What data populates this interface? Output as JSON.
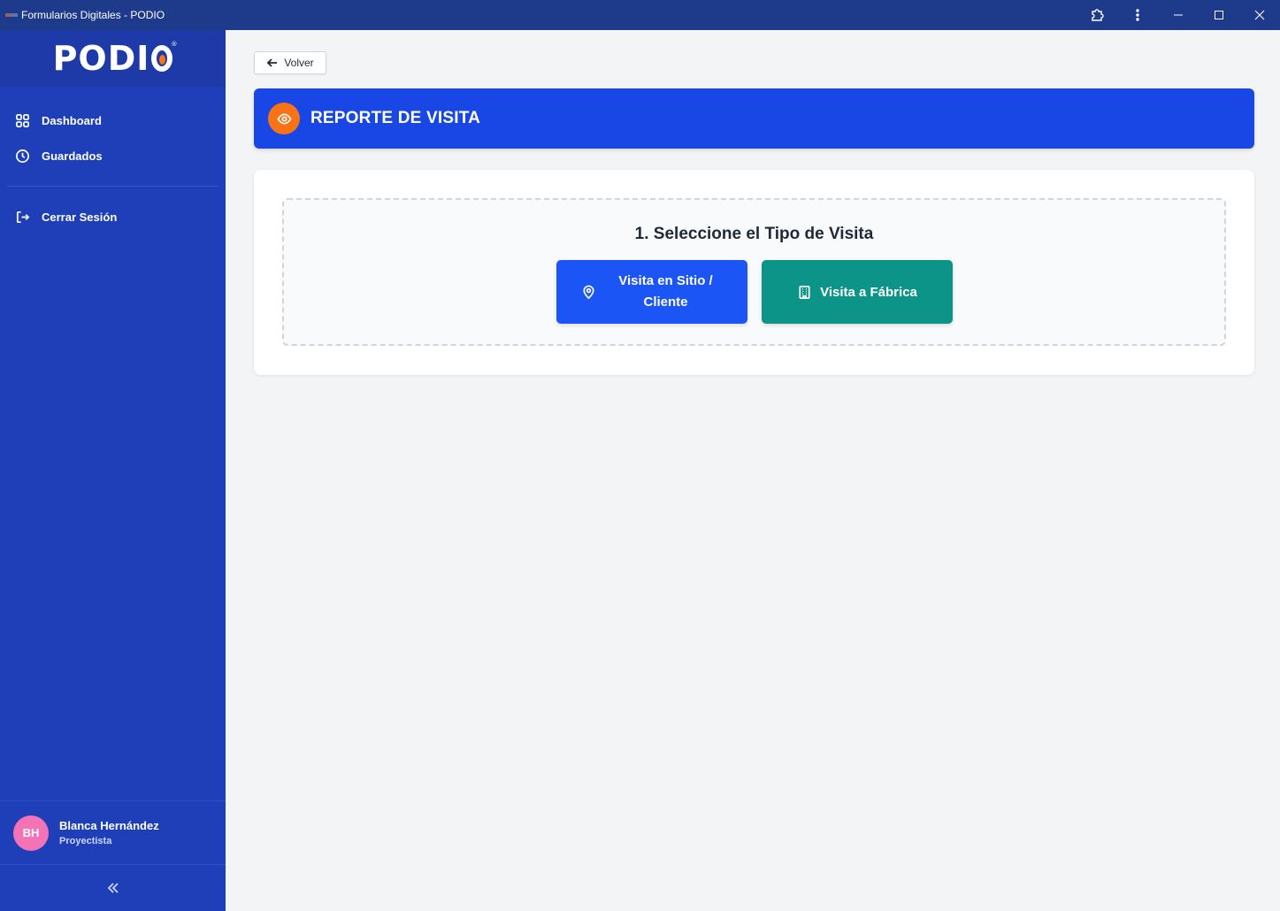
{
  "window": {
    "title": "Formularios Digitales - PODIO"
  },
  "sidebar": {
    "logo": "PODIO",
    "items": [
      {
        "label": "Dashboard",
        "icon": "grid-icon"
      },
      {
        "label": "Guardados",
        "icon": "clock-icon"
      }
    ],
    "logout_label": "Cerrar Sesión",
    "user": {
      "initials": "BH",
      "name": "Blanca Hernández",
      "role": "Proyectista"
    }
  },
  "main": {
    "back_label": "Volver",
    "banner_title": "REPORTE DE VISITA",
    "step_title": "1. Seleccione el Tipo de Visita",
    "options": [
      {
        "label": "Visita en Sitio / Cliente",
        "icon": "map-pin-icon",
        "color": "#1c55f5"
      },
      {
        "label": "Visita a Fábrica",
        "icon": "building-icon",
        "color": "#0d9488"
      }
    ]
  },
  "colors": {
    "sidebar": "#1e3fb8",
    "titlebar": "#1e3a8a",
    "banner": "#1847e6",
    "accent_orange": "#f97316",
    "avatar": "#f472b6"
  }
}
